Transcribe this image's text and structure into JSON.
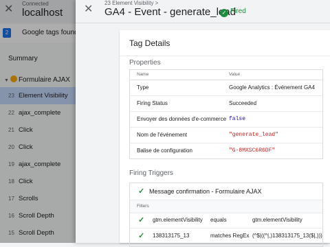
{
  "background": {
    "connected_label": "Connected",
    "host": "localhost",
    "tags_found_count": "2",
    "tags_found_label": "Google tags found",
    "summary_label": "Summary",
    "container_label": "Formulaire AJAX",
    "events": [
      {
        "num": "23",
        "label": "Element Visibility",
        "active": true
      },
      {
        "num": "22",
        "label": "ajax_complete"
      },
      {
        "num": "21",
        "label": "Click"
      },
      {
        "num": "20",
        "label": "Click"
      },
      {
        "num": "19",
        "label": "ajax_complete"
      },
      {
        "num": "18",
        "label": "Click"
      },
      {
        "num": "17",
        "label": "Scrolls"
      },
      {
        "num": "16",
        "label": "Scroll Depth"
      },
      {
        "num": "15",
        "label": "Scroll Depth"
      }
    ]
  },
  "panel": {
    "breadcrumb": "23 Element Visibility >",
    "title": "GA4 - Event - generate_lead",
    "status": "Fired",
    "status_color": "#1e8e3e"
  },
  "tag_details": {
    "title": "Tag Details",
    "properties_label": "Properties",
    "columns": {
      "name": "Name",
      "value": "Value"
    },
    "rows": [
      {
        "name": "Type",
        "value": "Google Analytics : Événement GA4"
      },
      {
        "name": "Firing Status",
        "value": "Succeeded"
      },
      {
        "name": "Envoyer des données d'e-commerce",
        "value": "false"
      },
      {
        "name": "Nom de l'événement",
        "value": "\"generate_lead\""
      },
      {
        "name": "Balise de configuration",
        "value": "\"G-8MXSC6R6DF\""
      }
    ],
    "firing_triggers_label": "Firing Triggers",
    "trigger": {
      "name": "Message confirmation - Formulaire AJAX",
      "filters_label": "Filters",
      "filters": [
        {
          "variable": "gtm.elementVisibility",
          "operator": "equals",
          "value": "gtm.elementVisibility"
        },
        {
          "variable": "138313175_13",
          "operator": "matches RegEx",
          "value": "(^$|((^|,)138313175_13($|,)))"
        }
      ]
    }
  }
}
